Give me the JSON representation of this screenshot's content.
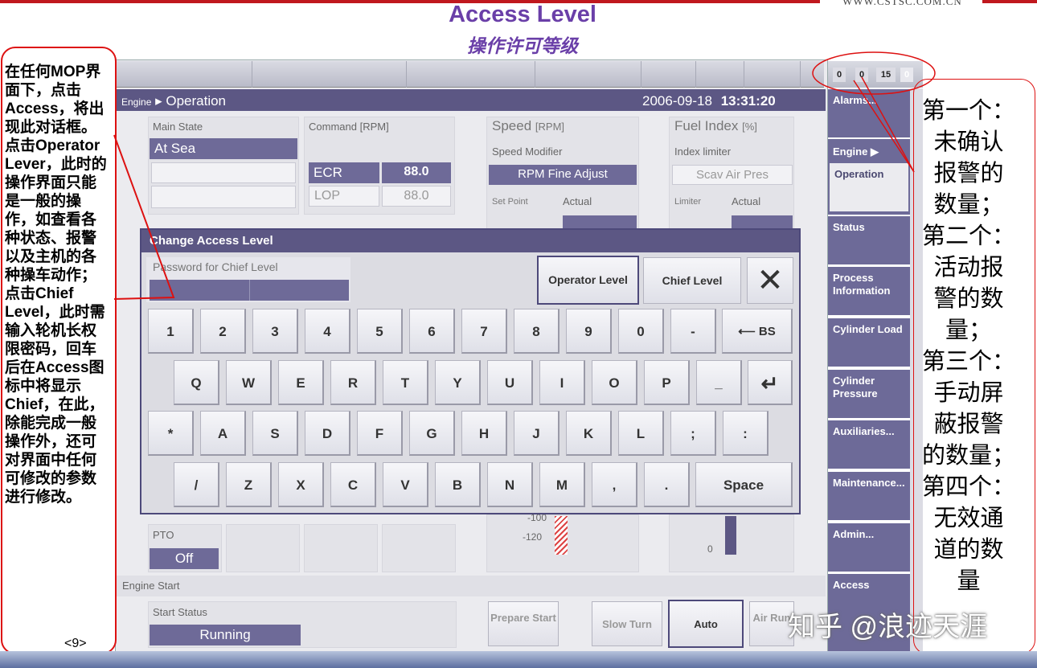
{
  "slide": {
    "logo": "WWW.CSTSC.COM.CN",
    "title": "Access Level",
    "subtitle": "操作许可等级",
    "page_num": "<9>",
    "watermark": "知乎 @浪迹天涯"
  },
  "left_annotation": "在任何MOP界面下，点击Access，将出现此对话框。点击Operator Lever，此时的操作界面只能是一般的操作，如查看各种状态、报警以及主机的各种操车动作；点击Chief Level，此时需输入轮机长权限密码，回车后在Access图标中将显示Chief，在此，除能完成一般操作外，还可对界面中任何可修改的参数进行修改。",
  "right_annotation": [
    "第一个：",
    "未确认",
    "报警的",
    "数量；",
    "第二个：",
    "活动报",
    "警的数",
    "量；",
    "第三个：",
    "手动屏",
    "蔽报警",
    "的数量；",
    "第四个：",
    "无效通",
    "道的数",
    "量"
  ],
  "alarm_counters": [
    "0",
    "0",
    "15",
    "0"
  ],
  "header": {
    "crumb_root": "Engine",
    "crumb_page": "Operation",
    "date": "2006-09-18",
    "time": "13:31:20"
  },
  "main_state": {
    "label": "Main State",
    "value": "At Sea"
  },
  "command": {
    "label": "Command [RPM]",
    "ecr_label": "ECR",
    "ecr_value": "88.0",
    "lop_label": "LOP",
    "lop_value": "88.0"
  },
  "speed": {
    "label": "Speed",
    "unit": "[RPM]",
    "modifier_label": "Speed Modifier",
    "modifier_value": "RPM Fine Adjust",
    "setpoint_label": "Set Point",
    "actual_label": "Actual",
    "gauge_ticks": [
      "-100",
      "-120"
    ]
  },
  "fuel": {
    "label": "Fuel Index",
    "unit": "[%]",
    "limiter_label": "Index limiter",
    "limiter_value": "Scav Air Pres",
    "limiter_col": "Limiter",
    "actual_label": "Actual",
    "gauge_ticks": [
      "0"
    ]
  },
  "pto": {
    "label": "PTO",
    "value": "Off"
  },
  "engine_start": {
    "label": "Engine Start",
    "status_label": "Start Status",
    "status_value": "Running",
    "buttons": [
      "Prepare Start",
      "Slow Turn",
      "Auto",
      "Air Run"
    ]
  },
  "nav": [
    {
      "label": "Alarms..."
    },
    {
      "label": "Engine ▶",
      "sub": "Operation"
    },
    {
      "label": "Status"
    },
    {
      "label": "Process Information"
    },
    {
      "label": "Cylinder Load"
    },
    {
      "label": "Cylinder Pressure"
    },
    {
      "label": "Auxiliaries..."
    },
    {
      "label": "Maintenance..."
    },
    {
      "label": "Admin..."
    },
    {
      "label": "Access"
    }
  ],
  "dialog": {
    "title": "Change Access Level",
    "password_label": "Password for Chief Level",
    "operator_btn": "Operator Level",
    "chief_btn": "Chief Level",
    "close_symbol": "✕",
    "row1": [
      "1",
      "2",
      "3",
      "4",
      "5",
      "6",
      "7",
      "8",
      "9",
      "0",
      "-"
    ],
    "bs": "⟵ BS",
    "row2": [
      "Q",
      "W",
      "E",
      "R",
      "T",
      "Y",
      "U",
      "I",
      "O",
      "P",
      "_"
    ],
    "enter": "↵",
    "row3": [
      "*",
      "A",
      "S",
      "D",
      "F",
      "G",
      "H",
      "J",
      "K",
      "L",
      ";",
      ":"
    ],
    "row4": [
      "/",
      "Z",
      "X",
      "C",
      "V",
      "B",
      "N",
      "M",
      ",",
      "."
    ],
    "space": "Space"
  }
}
